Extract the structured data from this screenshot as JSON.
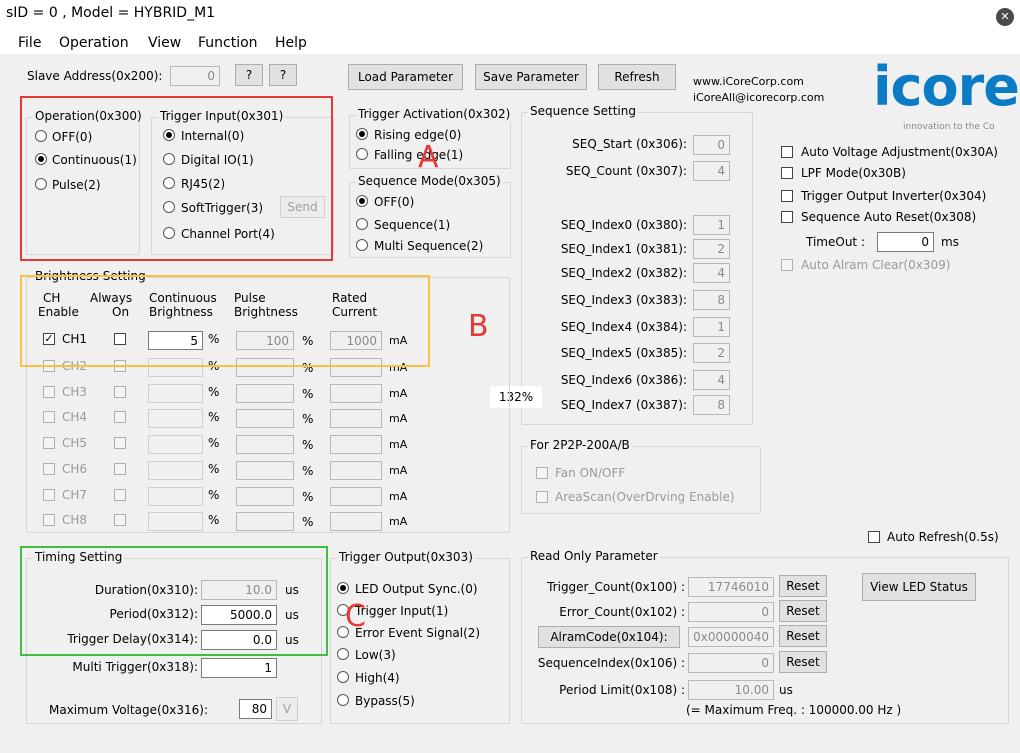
{
  "window": {
    "title": "sID = 0 , Model = HYBRID_M1"
  },
  "menu": [
    "File",
    "Operation",
    "View",
    "Function",
    "Help"
  ],
  "toolbar": {
    "slave_label": "Slave Address(0x200):",
    "slave_value": "0",
    "q1": "?",
    "q2": "?",
    "load": "Load Parameter",
    "save": "Save Parameter",
    "refresh": "Refresh",
    "website": "www.iCoreCorp.com",
    "email": "iCoreAll@icorecorp.com",
    "logo": "icore",
    "tagline": "innovation to the Co"
  },
  "operation": {
    "title": "Operation(0x300)",
    "options": [
      "OFF(0)",
      "Continuous(1)",
      "Pulse(2)"
    ],
    "selected": 1
  },
  "trigger_input": {
    "title": "Trigger Input(0x301)",
    "options": [
      "Internal(0)",
      "Digital IO(1)",
      "RJ45(2)",
      "SoftTrigger(3)",
      "Channel Port(4)"
    ],
    "selected": 0,
    "send": "Send"
  },
  "trigger_activation": {
    "title": "Trigger Activation(0x302)",
    "options": [
      "Rising edge(0)",
      "Falling edge(1)"
    ],
    "selected": 0
  },
  "sequence_mode": {
    "title": "Sequence Mode(0x305)",
    "options": [
      "OFF(0)",
      "Sequence(1)",
      "Multi Sequence(2)"
    ],
    "selected": 0
  },
  "sequence_setting": {
    "title": "Sequence Setting",
    "start_label": "SEQ_Start (0x306):",
    "start_value": "0",
    "count_label": "SEQ_Count (0x307):",
    "count_value": "4",
    "indexes": [
      {
        "label": "SEQ_Index0 (0x380):",
        "value": "1"
      },
      {
        "label": "SEQ_Index1 (0x381):",
        "value": "2"
      },
      {
        "label": "SEQ_Index2 (0x382):",
        "value": "4"
      },
      {
        "label": "SEQ_Index3 (0x383):",
        "value": "8"
      },
      {
        "label": "SEQ_Index4 (0x384):",
        "value": "1"
      },
      {
        "label": "SEQ_Index5 (0x385):",
        "value": "2"
      },
      {
        "label": "SEQ_Index6 (0x386):",
        "value": "4"
      },
      {
        "label": "SEQ_Index7 (0x387):",
        "value": "8"
      }
    ]
  },
  "options": {
    "auto_voltage": "Auto Voltage Adjustment(0x30A)",
    "lpf": "LPF Mode(0x30B)",
    "trigger_inverter": "Trigger Output Inverter(0x304)",
    "seq_auto_reset": "Sequence Auto Reset(0x308)",
    "timeout_label": "TimeOut :",
    "timeout_value": "0",
    "timeout_unit": "ms",
    "auto_alarm": "Auto Alram Clear(0x309)"
  },
  "brightness": {
    "title": "Brightness Setting",
    "headers": {
      "ch1": "CH",
      "ch2": "Enable",
      "al1": "Always",
      "al2": "On",
      "co1": "Continuous",
      "co2": "Brightness",
      "pu1": "Pulse",
      "pu2": "Brightness",
      "ra1": "Rated",
      "ra2": "Current"
    },
    "channels": [
      {
        "name": "CH1",
        "cont": "5",
        "pulse": "100",
        "rated": "1000"
      },
      {
        "name": "CH2",
        "cont": "",
        "pulse": "",
        "rated": ""
      },
      {
        "name": "CH3",
        "cont": "",
        "pulse": "",
        "rated": ""
      },
      {
        "name": "CH4",
        "cont": "",
        "pulse": "",
        "rated": ""
      },
      {
        "name": "CH5",
        "cont": "",
        "pulse": "",
        "rated": ""
      },
      {
        "name": "CH6",
        "cont": "",
        "pulse": "",
        "rated": ""
      },
      {
        "name": "CH7",
        "cont": "",
        "pulse": "",
        "rated": ""
      },
      {
        "name": "CH8",
        "cont": "",
        "pulse": "",
        "rated": ""
      }
    ],
    "pct": "%",
    "ma": "mA"
  },
  "zoom": "132%",
  "fan_group": {
    "title": "For 2P2P-200A/B",
    "fan": "Fan ON/OFF",
    "areascan": "AreaScan(OverDrving Enable)"
  },
  "auto_refresh": "Auto Refresh(0.5s)",
  "timing": {
    "title": "Timing Setting",
    "duration_label": "Duration(0x310):",
    "duration_value": "10.0",
    "period_label": "Period(0x312):",
    "period_value": "5000.0",
    "delay_label": "Trigger Delay(0x314):",
    "delay_value": "0.0",
    "unit": "us",
    "multi_label": "Multi Trigger(0x318):",
    "multi_value": "1",
    "maxv_label": "Maximum Voltage(0x316):",
    "maxv_value": "80",
    "maxv_unit": "V"
  },
  "trigger_output": {
    "title": "Trigger Output(0x303)",
    "options": [
      "LED Output Sync.(0)",
      "Trigger Input(1)",
      "Error Event Signal(2)",
      "Low(3)",
      "High(4)",
      "Bypass(5)"
    ],
    "selected": 0
  },
  "readonly": {
    "title": "Read Only Parameter",
    "trigger_count_label": "Trigger_Count(0x100) :",
    "trigger_count_value": "17746010",
    "error_count_label": "Error_Count(0x102) :",
    "error_count_value": "0",
    "alarm_label": "AlramCode(0x104):",
    "alarm_value": "0x00000040",
    "seqidx_label": "SequenceIndex(0x106) :",
    "seqidx_value": "0",
    "period_limit_label": "Period Limit(0x108) :",
    "period_limit_value": "10.00",
    "period_limit_unit": "us",
    "max_freq": "(= Maximum Freq. : 100000.00 Hz )",
    "reset": "Reset",
    "view_led": "View LED Status"
  },
  "annotations": {
    "a": "A",
    "b": "B",
    "c": "C"
  },
  "colors": {
    "annot_a": "#e53935",
    "annot_b": "#f5c242",
    "annot_c": "#3fbf3f",
    "logo": "#0a7bc4"
  }
}
